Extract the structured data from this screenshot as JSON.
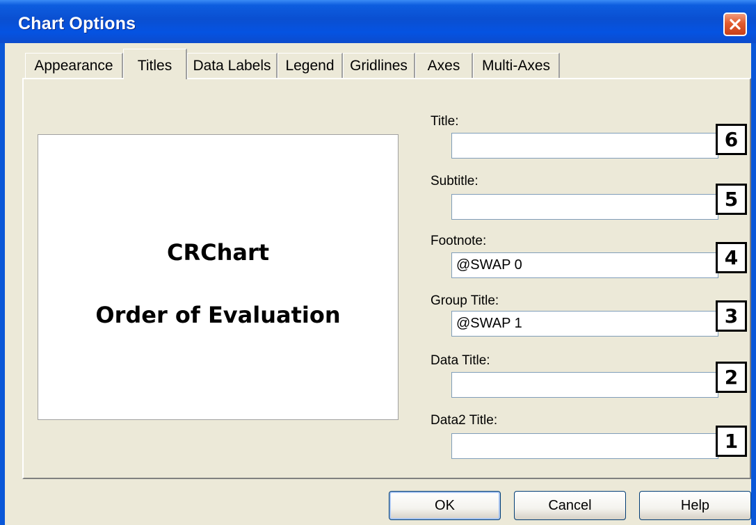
{
  "window": {
    "title": "Chart Options"
  },
  "tabs": [
    {
      "label": "Appearance",
      "active": false
    },
    {
      "label": "Titles",
      "active": true
    },
    {
      "label": "Data Labels",
      "active": false
    },
    {
      "label": "Legend",
      "active": false
    },
    {
      "label": "Gridlines",
      "active": false
    },
    {
      "label": "Axes",
      "active": false
    },
    {
      "label": "Multi-Axes",
      "active": false
    }
  ],
  "preview": {
    "line1": "CRChart",
    "line2": "Order of Evaluation"
  },
  "fields": [
    {
      "label": "Title:",
      "value": "",
      "order": "6"
    },
    {
      "label": "Subtitle:",
      "value": "",
      "order": "5"
    },
    {
      "label": "Footnote:",
      "value": "@SWAP 0",
      "order": "4"
    },
    {
      "label": "Group Title:",
      "value": "@SWAP 1",
      "order": "3"
    },
    {
      "label": "Data Title:",
      "value": "",
      "order": "2"
    },
    {
      "label": "Data2 Title:",
      "value": "",
      "order": "1"
    }
  ],
  "buttons": {
    "ok": "OK",
    "cancel": "Cancel",
    "help": "Help"
  },
  "colors": {
    "titlebar": "#0a4fd1",
    "dialog_face": "#ece9d8",
    "close_button": "#e25b2e",
    "input_border": "#7f9db9"
  },
  "icons": {
    "close": "close-icon"
  }
}
